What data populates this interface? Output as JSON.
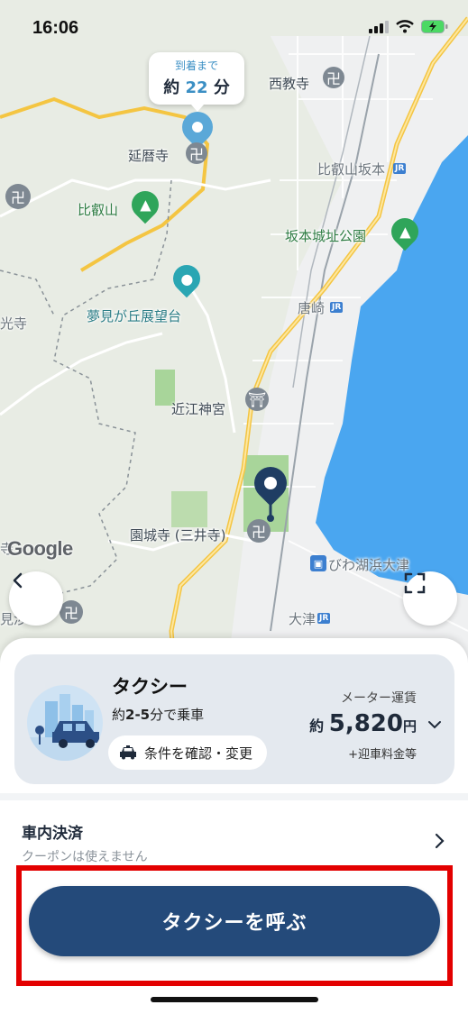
{
  "status_bar": {
    "time": "16:06"
  },
  "map": {
    "arrival_bubble": {
      "caption": "到着まで",
      "prefix": "約",
      "minutes": "22",
      "unit": "分"
    },
    "labels": {
      "saikyoji": "西教寺",
      "enryakuji": "延暦寺",
      "hieizan_sakamoto": "比叡山坂本",
      "hieizan": "比叡山",
      "sakamoto_castle": "坂本城址公園",
      "yumemigaoka": "夢見が丘展望台",
      "karasaki": "唐崎",
      "omi_jingu": "近江神宮",
      "onjoji": "園城寺 (三井寺)",
      "biwako_hamaotsu": "びわ湖浜大津",
      "otsu": "大津",
      "edge_ko": "光寺",
      "edge_ji": "寺",
      "edge_mi": "見涉"
    },
    "google_logo": "Google"
  },
  "service": {
    "name": "タクシー",
    "eta_prefix": "約",
    "eta_range": "2-5",
    "eta_suffix": "分で乗車",
    "conditions_label": "条件を確認・変更",
    "fare_label": "メーター運賃",
    "fare_prefix": "約",
    "fare_value": "5,820",
    "fare_unit": "円",
    "fare_note": "+迎車料金等"
  },
  "payment": {
    "title": "車内決済",
    "note": "クーポンは使えません"
  },
  "call_button": {
    "label": "タクシーを呼ぶ"
  },
  "colors": {
    "primary": "#244a7a",
    "accent": "#3b8fc4",
    "highlight": "#e30000",
    "lake": "#4aa6f0"
  }
}
